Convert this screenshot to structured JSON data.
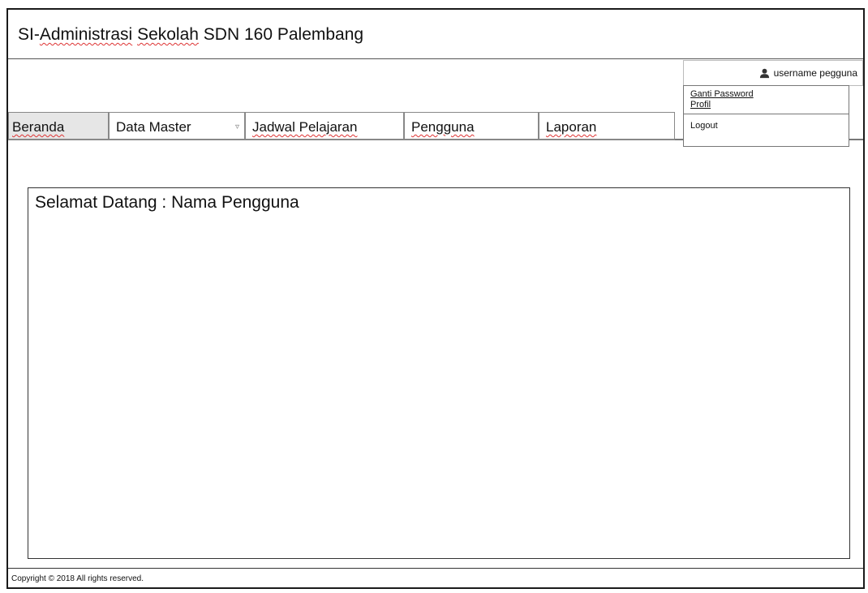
{
  "header": {
    "title_prefix": "SI-",
    "title_word1": "Administrasi",
    "title_word2": "Sekolah",
    "title_rest": "SDN 160 Palembang"
  },
  "user": {
    "username": "username pegguna",
    "icon": "user-icon",
    "menu": {
      "change_password": "Ganti Password",
      "profile": "Profil",
      "logout": "Logout"
    }
  },
  "nav": {
    "tabs": [
      {
        "label": "Beranda"
      },
      {
        "label": "Data Master",
        "caret": "▿"
      },
      {
        "label": "Jadwal Pelajaran"
      },
      {
        "label": "Pengguna"
      },
      {
        "label": "Laporan"
      }
    ]
  },
  "main": {
    "welcome": "Selamat Datang : Nama Pengguna"
  },
  "footer": {
    "copyright": "Copyright © 2018  All rights reserved."
  }
}
